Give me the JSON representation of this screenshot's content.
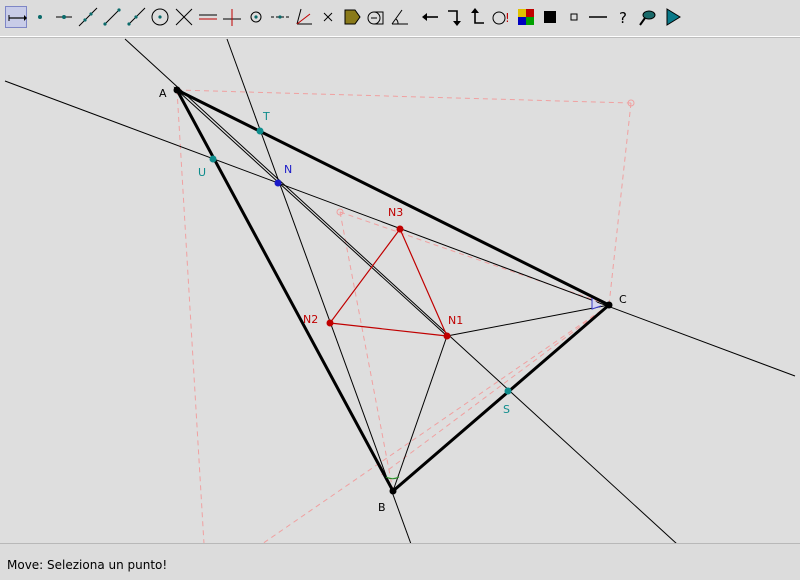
{
  "toolbar": {
    "tools": [
      {
        "name": "move-tool-icon",
        "active": true
      },
      {
        "name": "point-tool-icon"
      },
      {
        "name": "point-on-object-tool-icon"
      },
      {
        "name": "line-tool-icon"
      },
      {
        "name": "segment-tool-icon"
      },
      {
        "name": "ray-tool-icon"
      },
      {
        "name": "circle-tool-icon"
      },
      {
        "name": "intersect-tool-icon"
      },
      {
        "name": "parallel-line-tool-icon"
      },
      {
        "name": "perpendicular-line-tool-icon"
      },
      {
        "name": "midpoint-tool-icon"
      },
      {
        "name": "dotted-line-tool-icon"
      },
      {
        "name": "angle-bisector-tool-icon"
      },
      {
        "name": "close-x-tool-icon"
      },
      {
        "name": "polygon-fill-tool-icon"
      },
      {
        "name": "show-hide-tool-icon"
      },
      {
        "name": "angle-tool-icon"
      },
      {
        "name": "undo-arrow-icon"
      },
      {
        "name": "redo-arrow-icon"
      },
      {
        "name": "back-arrow-icon"
      },
      {
        "name": "warning-icon"
      },
      {
        "name": "color-palette-icon"
      },
      {
        "name": "black-square-icon"
      },
      {
        "name": "small-square-icon"
      },
      {
        "name": "line-style-icon"
      },
      {
        "name": "help-question-icon"
      },
      {
        "name": "zoom-tool-icon"
      },
      {
        "name": "play-icon"
      }
    ]
  },
  "canvas": {
    "points": {
      "A": {
        "label": "A",
        "color": "#000000"
      },
      "B": {
        "label": "B",
        "color": "#000000"
      },
      "C": {
        "label": "C",
        "color": "#000000"
      },
      "T": {
        "label": "T",
        "color": "#0e8c8c"
      },
      "U": {
        "label": "U",
        "color": "#0e8c8c"
      },
      "S": {
        "label": "S",
        "color": "#0e8c8c"
      },
      "N": {
        "label": "N",
        "color": "#1a1ac8"
      },
      "N1": {
        "label": "N1",
        "color": "#c00000"
      },
      "N2": {
        "label": "N2",
        "color": "#c00000"
      },
      "N3": {
        "label": "N3",
        "color": "#c00000"
      }
    },
    "colors": {
      "background": "#dedede",
      "triangle": "#000000",
      "napoleon": "#c00000",
      "construction_dashed": "#f0a0a0"
    }
  },
  "status": {
    "text": "Move: Seleziona un punto!"
  }
}
